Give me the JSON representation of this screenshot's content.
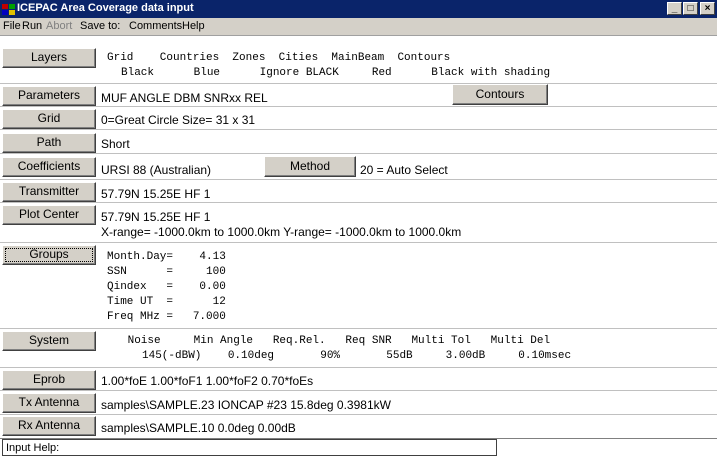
{
  "window": {
    "title": "ICEPAC Area Coverage data input",
    "minimize": "_",
    "maximize": "□",
    "close": "×"
  },
  "menu": {
    "file": "File",
    "run": "Run",
    "abort": "Abort",
    "save_to": "Save to:",
    "comments": "Comments",
    "help": "Help"
  },
  "buttons": {
    "layers": "Layers",
    "parameters": "Parameters",
    "grid": "Grid",
    "path": "Path",
    "coefficients": "Coefficients",
    "transmitter": "Transmitter",
    "plot_center": "Plot Center",
    "groups": "Groups",
    "system": "System",
    "eprob": "Eprob",
    "tx_antenna": "Tx Antenna",
    "rx_antenna": "Rx Antenna",
    "contours": "Contours",
    "method": "Method"
  },
  "layers": {
    "header": "Grid    Countries  Zones  Cities  MainBeam  Contours",
    "values": "Black      Blue      Ignore BLACK     Red      Black with shading"
  },
  "parameters": "MUF   ANGLE   DBM    SNRxx   REL",
  "grid": "0=Great Circle    Size= 31 x 31",
  "path": "Short",
  "coefficients": {
    "value": "URSI 88 (Australian)",
    "method_value": "20 = Auto Select"
  },
  "transmitter": "57.79N   15.25E   HF 1",
  "plot_center": "57.79N   15.25E   HF 1",
  "range": "X-range= -1000.0km  to   1000.0km     Y-range= -1000.0km  to   1000.0km",
  "groups": [
    "Month.Day=    4.13",
    "SSN      =     100",
    "Qindex   =    0.00",
    "Time UT  =      12",
    "Freq MHz =   7.000"
  ],
  "system": {
    "header": " Noise     Min Angle   Req.Rel.   Req SNR   Multi Tol   Multi Del",
    "values": "145(-dBW)    0.10deg       90%       55dB     3.00dB     0.10msec"
  },
  "eprob": "1.00*foE   1.00*foF1   1.00*foF2   0.70*foEs",
  "tx_antenna": "samples\\SAMPLE.23    IONCAP #23   15.8deg   0.3981kW",
  "rx_antenna": "samples\\SAMPLE.10       0.0deg   0.00dB",
  "input_help": "Input Help:"
}
